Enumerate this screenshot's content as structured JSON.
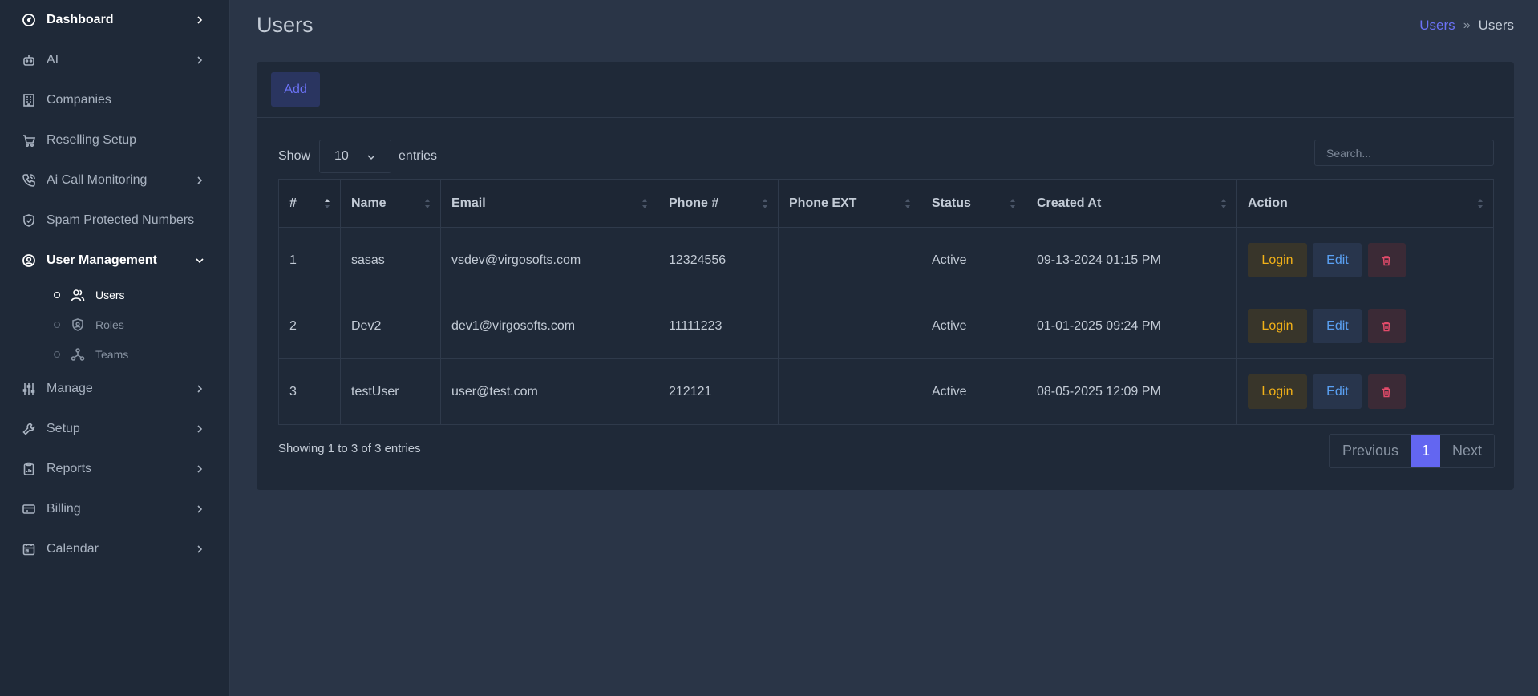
{
  "sidebar": {
    "items": [
      {
        "label": "Dashboard",
        "icon": "dashboard-gauge-icon"
      },
      {
        "label": "AI",
        "icon": "robot-icon"
      },
      {
        "label": "Companies",
        "icon": "building-icon"
      },
      {
        "label": "Reselling Setup",
        "icon": "cart-icon"
      },
      {
        "label": "Ai Call Monitoring",
        "icon": "phone-call-icon"
      },
      {
        "label": "Spam Protected Numbers",
        "icon": "shield-check-icon"
      },
      {
        "label": "User Management",
        "icon": "user-circle-icon"
      },
      {
        "label": "Manage",
        "icon": "sliders-icon"
      },
      {
        "label": "Setup",
        "icon": "wrench-icon"
      },
      {
        "label": "Reports",
        "icon": "clipboard-chart-icon"
      },
      {
        "label": "Billing",
        "icon": "credit-card-icon"
      },
      {
        "label": "Calendar",
        "icon": "calendar-icon"
      }
    ],
    "sub_items": [
      {
        "label": "Users",
        "icon": "users-icon"
      },
      {
        "label": "Roles",
        "icon": "shield-user-icon"
      },
      {
        "label": "Teams",
        "icon": "network-icon"
      }
    ]
  },
  "header": {
    "title": "Users",
    "breadcrumb": {
      "link": "Users",
      "separator": "»",
      "current": "Users"
    }
  },
  "toolbar": {
    "add_label": "Add"
  },
  "table_controls": {
    "show_label": "Show",
    "entries_value": "10",
    "entries_label": "entries",
    "search_placeholder": "Search..."
  },
  "table": {
    "columns": [
      "#",
      "Name",
      "Email",
      "Phone #",
      "Phone EXT",
      "Status",
      "Created At",
      "Action"
    ],
    "rows": [
      {
        "num": "1",
        "name": "sasas",
        "email": "vsdev@virgosofts.com",
        "phone": "12324556",
        "ext": "",
        "status": "Active",
        "created": "09-13-2024 01:15 PM"
      },
      {
        "num": "2",
        "name": "Dev2",
        "email": "dev1@virgosofts.com",
        "phone": "11111223",
        "ext": "",
        "status": "Active",
        "created": "01-01-2025 09:24 PM"
      },
      {
        "num": "3",
        "name": "testUser",
        "email": "user@test.com",
        "phone": "212121",
        "ext": "",
        "status": "Active",
        "created": "08-05-2025 12:09 PM"
      }
    ],
    "actions": {
      "login": "Login",
      "edit": "Edit",
      "delete_icon": "trash-icon"
    }
  },
  "footer": {
    "info": "Showing 1 to 3 of 3 entries",
    "pagination": {
      "previous": "Previous",
      "current": "1",
      "next": "Next"
    }
  },
  "colors": {
    "accent": "#6366f1",
    "login": "#f2b118",
    "edit": "#5aa0f2",
    "delete": "#e34b6a"
  }
}
